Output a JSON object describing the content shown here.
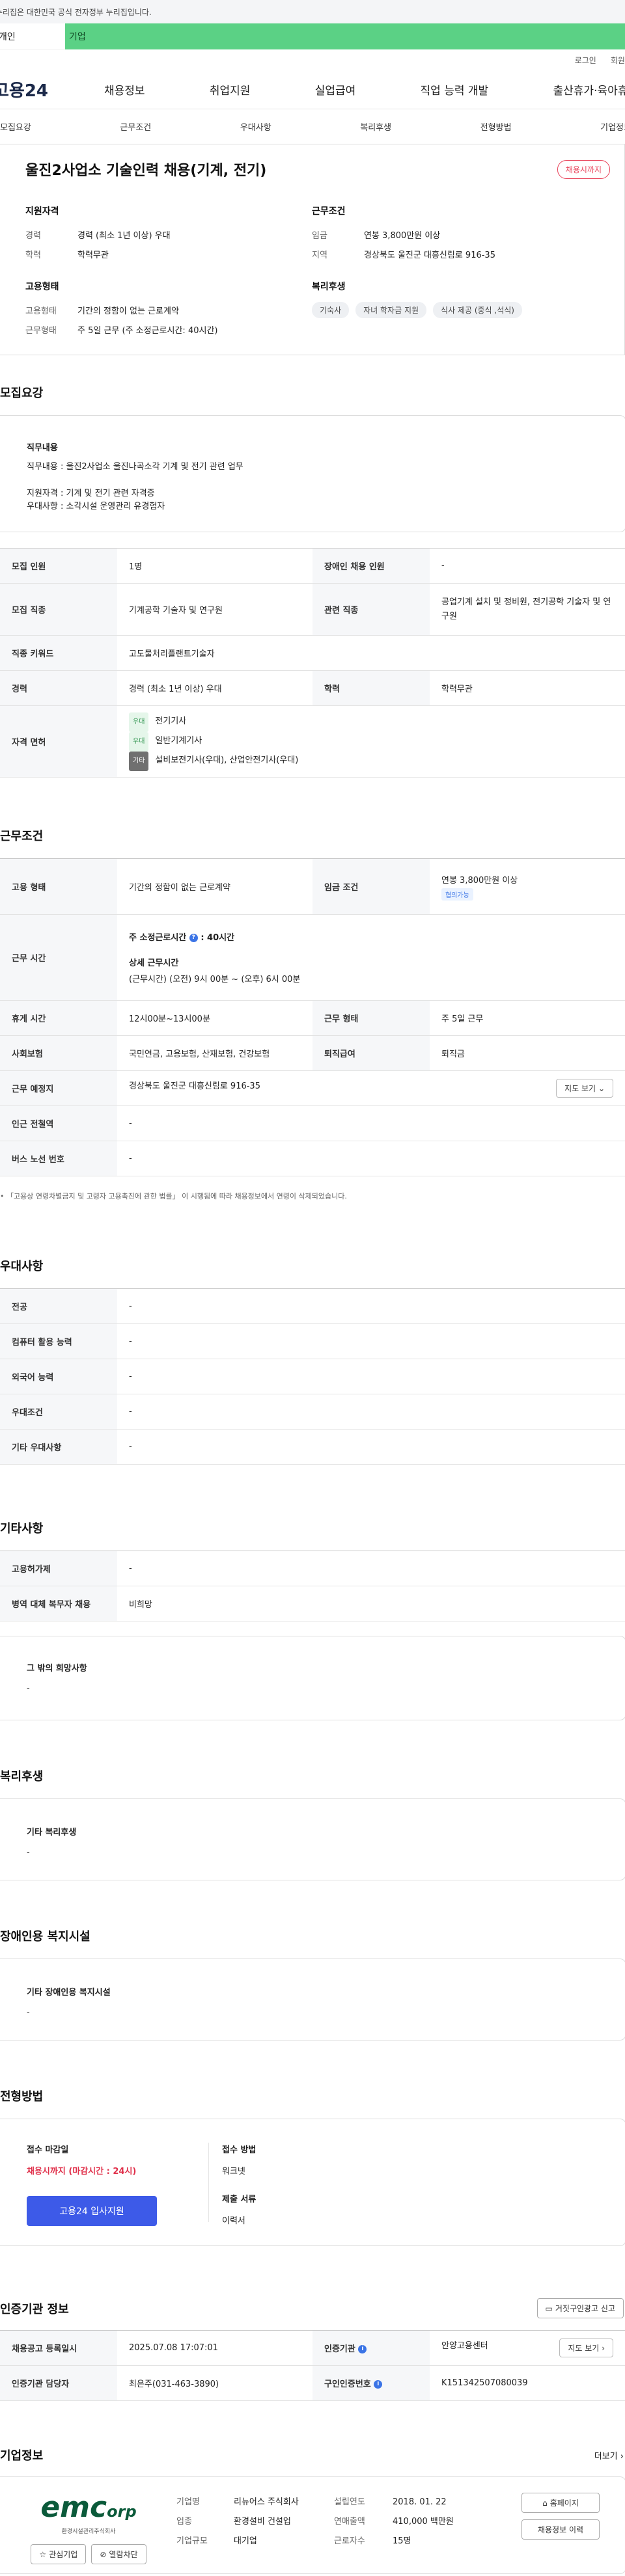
{
  "gov_banner": "이 누리집은 대한민국 공식 전자정부 누리집입니다.",
  "top_tabs": {
    "personal": "개인",
    "corporate": "기업"
  },
  "util": {
    "login": "로그인",
    "join": "회원가입"
  },
  "gnb": {
    "logo": "고용24",
    "menu": [
      "채용정보",
      "취업지원",
      "실업급여",
      "직업 능력 개발",
      "출산휴가·육아휴직"
    ]
  },
  "subnav": [
    "모집요강",
    "근무조건",
    "우대사항",
    "복리후생",
    "전형방법",
    "기업정보"
  ],
  "summary": {
    "title": "울진2사업소 기술인력 채용(기계, 전기)",
    "badge": "채용시까지",
    "qualification": {
      "title": "지원자격",
      "career_k": "경력",
      "career_v": "경력 (최소 1년 이상) 우대",
      "edu_k": "학력",
      "edu_v": "학력무관"
    },
    "conditions": {
      "title": "근무조건",
      "wage_k": "임금",
      "wage_v": "연봉 3,800만원 이상",
      "region_k": "지역",
      "region_v": "경상북도 울진군 대흥신림로 916-35"
    },
    "employment": {
      "title": "고용형태",
      "type_k": "고용형태",
      "type_v": "기간의 정함이 없는 근로계약",
      "shape_k": "근무형태",
      "shape_v": "주 5일 근무 (주 소정근로시간: 40시간)"
    },
    "welfare": {
      "title": "복리후생",
      "chips": [
        "기숙사",
        "자녀 학자금 지원",
        "식사 제공 (중식 ,석식)"
      ]
    }
  },
  "recruit": {
    "section_title": "모집요강",
    "duty_title": "직무내용",
    "duty_text": "직무내용 : 울진2사업소 울진나곡소각 기계 및 전기 관련 업무",
    "req_line1": "지원자격 : 기계 및 전기 관련 자격증",
    "req_line2": "우대사항 : 소각시설 운영관리 유경험자",
    "rows": {
      "count_h": "모집 인원",
      "count_v": "1명",
      "disabled_h": "장애인 채용 인원",
      "disabled_v": "-",
      "job_h": "모집 직종",
      "job_v": "기계공학 기술자 및 연구원",
      "related_h": "관련 직종",
      "related_v": "공업기계 설치 및 정비원, 전기공학 기술자 및 연구원",
      "keyword_h": "직종 키워드",
      "keyword_v": "고도물처리플랜트기술자",
      "career_h": "경력",
      "career_v": "경력 (최소 1년 이상) 우대",
      "edu_h": "학력",
      "edu_v": "학력무관",
      "license_h": "자격 면허",
      "licenses": [
        {
          "tag": "우대",
          "name": "전기기사"
        },
        {
          "tag": "우대",
          "name": "일반기계기사"
        },
        {
          "tag": "기타",
          "name": "설비보전기사(우대), 산업안전기사(우대)"
        }
      ]
    }
  },
  "work": {
    "section_title": "근무조건",
    "type_h": "고용 형태",
    "type_v": "기간의 정함이 없는 근로계약",
    "wage_h": "임금 조건",
    "wage_v": "연봉 3,800만원 이상",
    "wage_tag": "협의가능",
    "hours_h": "근무 시간",
    "hours_weekly_label": "주 소정근로시간",
    "hours_weekly_value": ": 40시간",
    "hours_detail_title": "상세 근무시간",
    "hours_detail": "(근무시간) (오전) 9시 00분 ~ (오후) 6시 00분",
    "break_h": "휴게 시간",
    "break_v": "12시00분~13시00분",
    "shape_h": "근무 형태",
    "shape_v": "주 5일 근무",
    "insurance_h": "사회보험",
    "insurance_v": "국민연금, 고용보험, 산재보험, 건강보험",
    "severance_h": "퇴직급여",
    "severance_v": "퇴직금",
    "place_h": "근무 예정지",
    "place_v": "경상북도 울진군 대흥신림로 916-35",
    "map_btn": "지도 보기",
    "subway_h": "인근 전철역",
    "subway_v": "-",
    "bus_h": "버스 노선 번호",
    "bus_v": "-",
    "note": "「고용상 연령차별금지 및 고령자 고용촉진에 관한 법률」 이 시행됨에 따라 채용정보에서 연령이 삭제되었습니다."
  },
  "preference": {
    "section_title": "우대사항",
    "rows": [
      {
        "h": "전공",
        "v": "-"
      },
      {
        "h": "컴퓨터 활용 능력",
        "v": "-"
      },
      {
        "h": "외국어 능력",
        "v": "-"
      },
      {
        "h": "우대조건",
        "v": "-"
      },
      {
        "h": "기타 우대사항",
        "v": "-"
      }
    ]
  },
  "etc": {
    "section_title": "기타사항",
    "rows": [
      {
        "h": "고용허가제",
        "v": "-"
      },
      {
        "h": "병역 대체 복무자 채용",
        "v": "비희망"
      }
    ],
    "box_title": "그 밖의 희망사항",
    "box_value": "-"
  },
  "welfare": {
    "section_title": "복리후생",
    "box_title": "기타 복리후생",
    "box_value": "-"
  },
  "facility": {
    "section_title": "장애인용 복지시설",
    "box_title": "기타 장애인용 복지시설",
    "box_value": "-"
  },
  "selection": {
    "section_title": "전형방법",
    "deadline_title": "접수 마감일",
    "deadline_value": "채용시까지 (마감시간 : 24시)",
    "apply_btn": "고용24 입사지원",
    "method_title": "접수 방법",
    "method_value": "워크넷",
    "docs_title": "제출 서류",
    "docs_value": "이력서"
  },
  "cert": {
    "section_title": "인증기관 정보",
    "report_btn": "거짓구인광고 신고",
    "reg_h": "채용공고 등록일시",
    "reg_v": "2025.07.08 17:07:01",
    "agency_h": "인증기관",
    "agency_v": "안양고용센터",
    "map_btn": "지도 보기",
    "manager_h": "인증기관 담당자",
    "manager_v": "최은주(031-463-3890)",
    "cert_no_h": "구인인증번호",
    "cert_no_v": "K151342507080039"
  },
  "company": {
    "section_title": "기업정보",
    "more": "더보기",
    "logo_text": "emc",
    "logo_suffix": "orp",
    "logo_sub": "환경시설관리주식회사",
    "fav_btn": "관심기업",
    "block_btn": "열람차단",
    "name_h": "기업명",
    "name_v": "리뉴어스 주식회사",
    "industry_h": "업종",
    "industry_v": "환경설비 건설업",
    "scale_h": "기업규모",
    "scale_v": "대기업",
    "founded_h": "설립연도",
    "founded_v": "2018. 01. 22",
    "sales_h": "연매출액",
    "sales_v": "410,000 백만원",
    "employees_h": "근로자수",
    "employees_v": "15명",
    "homepage_btn": "홈페이지",
    "history_btn": "채용정보 이력"
  }
}
